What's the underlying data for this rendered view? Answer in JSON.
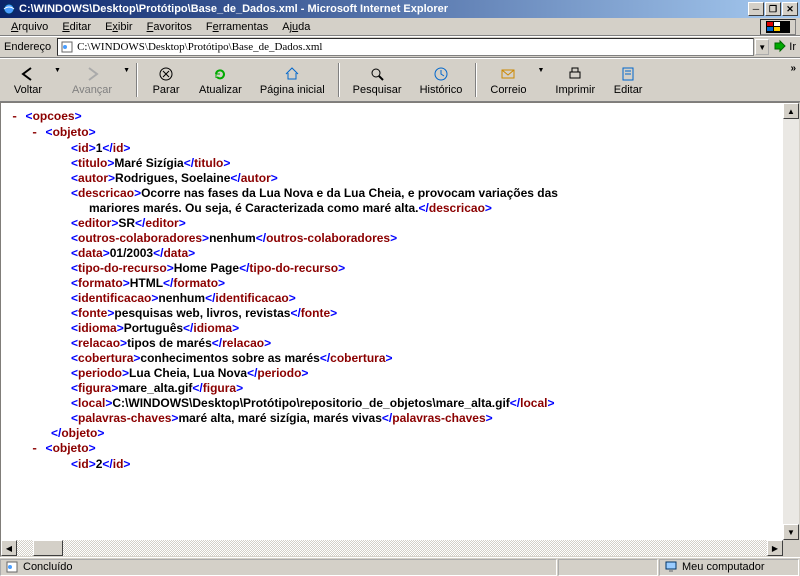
{
  "titlebar": {
    "text": "C:\\WINDOWS\\Desktop\\Protótipo\\Base_de_Dados.xml - Microsoft Internet Explorer"
  },
  "menu": {
    "arquivo": "Arquivo",
    "editar": "Editar",
    "exibir": "Exibir",
    "favoritos": "Favoritos",
    "ferramentas": "Ferramentas",
    "ajuda": "Ajuda"
  },
  "address": {
    "label": "Endereço",
    "value": "C:\\WINDOWS\\Desktop\\Protótipo\\Base_de_Dados.xml",
    "go": "Ir"
  },
  "toolbar": {
    "voltar": "Voltar",
    "avancar": "Avançar",
    "parar": "Parar",
    "atualizar": "Atualizar",
    "pagina_inicial": "Página inicial",
    "pesquisar": "Pesquisar",
    "historico": "Histórico",
    "correio": "Correio",
    "imprimir": "Imprimir",
    "editar_btn": "Editar"
  },
  "xml": {
    "root": "opcoes",
    "obj": "objeto",
    "fields": {
      "id": {
        "tag": "id",
        "val": "1"
      },
      "titulo": {
        "tag": "titulo",
        "val": "Maré Sizígia"
      },
      "autor": {
        "tag": "autor",
        "val": "Rodrigues, Soelaine"
      },
      "descricao": {
        "tag": "descricao",
        "val1": "Ocorre nas fases da Lua Nova e da Lua Cheia, e provocam variações das",
        "val2": "mariores marés. Ou seja, é Caracterizada como maré alta."
      },
      "editor": {
        "tag": "editor",
        "val": "SR"
      },
      "outros": {
        "tag": "outros-colaboradores",
        "val": "nenhum"
      },
      "data": {
        "tag": "data",
        "val": "01/2003"
      },
      "tipo": {
        "tag": "tipo-do-recurso",
        "val": "Home Page"
      },
      "formato": {
        "tag": "formato",
        "val": "HTML"
      },
      "ident": {
        "tag": "identificacao",
        "val": "nenhum"
      },
      "fonte": {
        "tag": "fonte",
        "val": "pesquisas web, livros, revistas"
      },
      "idioma": {
        "tag": "idioma",
        "val": "Português"
      },
      "relacao": {
        "tag": "relacao",
        "val": "tipos de marés"
      },
      "cobertura": {
        "tag": "cobertura",
        "val": "conhecimentos sobre as marés"
      },
      "periodo": {
        "tag": "periodo",
        "val": "Lua Cheia, Lua Nova"
      },
      "figura": {
        "tag": "figura",
        "val": "mare_alta.gif"
      },
      "local": {
        "tag": "local",
        "val": "C:\\WINDOWS\\Desktop\\Protótipo\\repositorio_de_objetos\\mare_alta.gif"
      },
      "palavras": {
        "tag": "palavras-chaves",
        "val": "maré alta, maré sizígia, marés vivas"
      },
      "id2": {
        "tag": "id",
        "val": "2"
      }
    }
  },
  "status": {
    "done": "Concluído",
    "zone": "Meu computador"
  }
}
